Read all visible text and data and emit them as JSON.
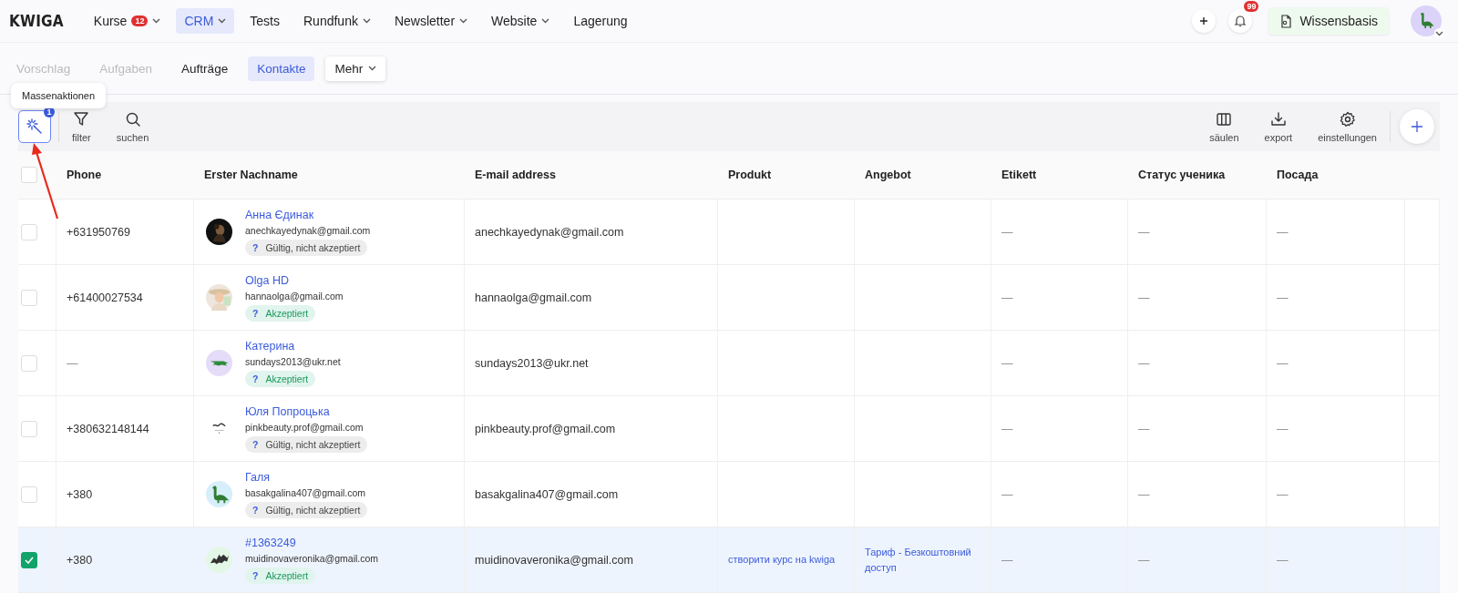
{
  "top_nav": {
    "logo": "KWIGA",
    "items": [
      {
        "label": "Kurse",
        "badge": "12",
        "dropdown": true,
        "selected": false
      },
      {
        "label": "CRM",
        "dropdown": true,
        "selected": true
      },
      {
        "label": "Tests",
        "dropdown": false,
        "selected": false
      },
      {
        "label": "Rundfunk",
        "dropdown": true,
        "selected": false
      },
      {
        "label": "Newsletter",
        "dropdown": true,
        "selected": false
      },
      {
        "label": "Website",
        "dropdown": true,
        "selected": false
      },
      {
        "label": "Lagerung",
        "dropdown": false,
        "selected": false
      }
    ],
    "notifications_badge": "99",
    "knowledge_button": "Wissensbasis"
  },
  "sub_nav": [
    {
      "label": "Vorschlag",
      "disabled": true,
      "selected": false,
      "dropdown": false
    },
    {
      "label": "Aufgaben",
      "disabled": true,
      "selected": false,
      "dropdown": false
    },
    {
      "label": "Aufträge",
      "disabled": false,
      "selected": false,
      "dropdown": false
    },
    {
      "label": "Kontakte",
      "disabled": false,
      "selected": true,
      "dropdown": false
    },
    {
      "label": "Mehr",
      "disabled": false,
      "selected": false,
      "dropdown": true
    }
  ],
  "toolbar": {
    "tooltip": "Massenaktionen",
    "left": [
      {
        "kind": "bulk",
        "badge": "1",
        "selected": true
      },
      {
        "kind": "filter",
        "label": "filter",
        "selected": false
      },
      {
        "kind": "search",
        "label": "suchen",
        "selected": false
      }
    ],
    "right": [
      {
        "kind": "columns",
        "label": "säulen"
      },
      {
        "kind": "export",
        "label": "export"
      },
      {
        "kind": "settings",
        "label": "einstellungen"
      }
    ]
  },
  "table": {
    "header_checked": false,
    "columns": [
      "Phone",
      "Erster Nachname",
      "E-mail address",
      "Produkt",
      "Angebot",
      "Etikett",
      "Статус ученика",
      "Посада"
    ],
    "rows": [
      {
        "checked": false,
        "phone": "+631950769",
        "name": "Анна Єдинак",
        "name_email": "anechkayedynak@gmail.com",
        "status": {
          "kind": "pending",
          "mark": "?",
          "label": "Gültig, nicht akzeptiert"
        },
        "email": "anechkayedynak@gmail.com",
        "label": "—",
        "student_status": "—",
        "position": "—"
      },
      {
        "checked": false,
        "phone": "+61400027534",
        "name": "Olga HD",
        "name_email": "hannaolga@gmail.com",
        "status": {
          "kind": "accepted",
          "mark": "?",
          "label": "Akzeptiert"
        },
        "email": "hannaolga@gmail.com",
        "label": "—",
        "student_status": "—",
        "position": "—"
      },
      {
        "checked": false,
        "phone": "—",
        "name": "Катерина",
        "name_email": "sundays2013@ukr.net",
        "status": {
          "kind": "accepted",
          "mark": "?",
          "label": "Akzeptiert"
        },
        "email": "sundays2013@ukr.net",
        "label": "—",
        "student_status": "—",
        "position": "—"
      },
      {
        "checked": false,
        "phone": "+380632148144",
        "name": "Юля Попроцька",
        "name_email": "pinkbeauty.prof@gmail.com",
        "status": {
          "kind": "pending",
          "mark": "?",
          "label": "Gültig, nicht akzeptiert"
        },
        "email": "pinkbeauty.prof@gmail.com",
        "label": "—",
        "student_status": "—",
        "position": "—"
      },
      {
        "checked": false,
        "phone": "+380",
        "name": "Галя",
        "name_email": "basakgalina407@gmail.com",
        "status": {
          "kind": "pending",
          "mark": "?",
          "label": "Gültig, nicht akzeptiert"
        },
        "email": "basakgalina407@gmail.com",
        "label": "—",
        "student_status": "—",
        "position": "—"
      },
      {
        "checked": true,
        "phone": "+380",
        "name": "#1363249",
        "name_email": "muidinovaveronika@gmail.com",
        "status": {
          "kind": "accepted",
          "mark": "?",
          "label": "Akzeptiert"
        },
        "email": "muidinovaveronika@gmail.com",
        "product": "створити курс на kwiga",
        "offer": "Тариф - Безкоштовний доступ",
        "label": "—",
        "student_status": "—",
        "position": "—"
      }
    ]
  }
}
